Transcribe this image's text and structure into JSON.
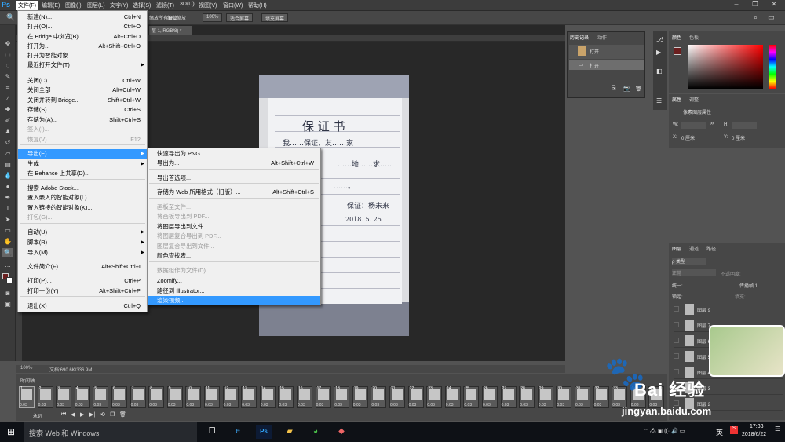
{
  "menubar": {
    "logo": "Ps",
    "items": [
      "文件(F)",
      "编辑(E)",
      "图像(I)",
      "图层(L)",
      "文字(Y)",
      "选择(S)",
      "滤镜(T)",
      "3D(D)",
      "视图(V)",
      "窗口(W)",
      "帮助(H)"
    ]
  },
  "options": {
    "checkbox_window": "缩放所有窗口",
    "fine_zoom": "细微缩放",
    "zoom_value": "100%",
    "fit_screen": "适合屏幕",
    "fill_screen": "填充屏幕"
  },
  "document": {
    "tab": "层 1, RGB/8) *",
    "zoom": "100%",
    "doc_size": "文档:690.6K/336.9M"
  },
  "photo": {
    "title": "保 证 书",
    "line1": "我……保证，友……家",
    "line2": "……地……求……",
    "line3": "……。",
    "signature": "保证：杨未来",
    "date": "2018. 5. 25"
  },
  "file_menu": {
    "items": [
      {
        "label": "新建(N)...",
        "shortcut": "Ctrl+N"
      },
      {
        "label": "打开(O)...",
        "shortcut": "Ctrl+O"
      },
      {
        "label": "在 Bridge 中浏览(B)...",
        "shortcut": "Alt+Ctrl+O"
      },
      {
        "label": "打开为...",
        "shortcut": "Alt+Shift+Ctrl+O"
      },
      {
        "label": "打开为智能对象...",
        "shortcut": ""
      },
      {
        "label": "最近打开文件(T)",
        "shortcut": ""
      },
      {
        "label": "关闭(C)",
        "shortcut": "Ctrl+W"
      },
      {
        "label": "关闭全部",
        "shortcut": "Alt+Ctrl+W"
      },
      {
        "label": "关闭并转到 Bridge...",
        "shortcut": "Shift+Ctrl+W"
      },
      {
        "label": "存储(S)",
        "shortcut": "Ctrl+S"
      },
      {
        "label": "存储为(A)...",
        "shortcut": "Shift+Ctrl+S"
      },
      {
        "label": "签入(I)...",
        "shortcut": ""
      },
      {
        "label": "恢复(V)",
        "shortcut": "F12"
      },
      {
        "label": "导出(E)",
        "shortcut": ""
      },
      {
        "label": "生成",
        "shortcut": ""
      },
      {
        "label": "在 Behance 上共享(D)...",
        "shortcut": ""
      },
      {
        "label": "搜索 Adobe Stock...",
        "shortcut": ""
      },
      {
        "label": "置入嵌入的智能对象(L)...",
        "shortcut": ""
      },
      {
        "label": "置入链接的智能对象(K)...",
        "shortcut": ""
      },
      {
        "label": "打包(G)...",
        "shortcut": ""
      },
      {
        "label": "自动(U)",
        "shortcut": ""
      },
      {
        "label": "脚本(R)",
        "shortcut": ""
      },
      {
        "label": "导入(M)",
        "shortcut": ""
      },
      {
        "label": "文件简介(F)...",
        "shortcut": "Alt+Shift+Ctrl+I"
      },
      {
        "label": "打印(P)...",
        "shortcut": "Ctrl+P"
      },
      {
        "label": "打印一份(Y)",
        "shortcut": "Alt+Shift+Ctrl+P"
      },
      {
        "label": "退出(X)",
        "shortcut": "Ctrl+Q"
      }
    ]
  },
  "export_menu": {
    "items": [
      {
        "label": "快速导出为 PNG",
        "shortcut": ""
      },
      {
        "label": "导出为...",
        "shortcut": "Alt+Shift+Ctrl+W"
      },
      {
        "label": "导出首选项...",
        "shortcut": ""
      },
      {
        "label": "存储为 Web 所用格式（旧版）...",
        "shortcut": "Alt+Shift+Ctrl+S"
      },
      {
        "label": "画板至文件...",
        "shortcut": ""
      },
      {
        "label": "将画板导出到 PDF...",
        "shortcut": ""
      },
      {
        "label": "将图层导出到文件...",
        "shortcut": ""
      },
      {
        "label": "将图层复合导出到 PDF...",
        "shortcut": ""
      },
      {
        "label": "图层复合导出到文件...",
        "shortcut": ""
      },
      {
        "label": "颜色查找表...",
        "shortcut": ""
      },
      {
        "label": "数据组作为文件(D)...",
        "shortcut": ""
      },
      {
        "label": "Zoomify...",
        "shortcut": ""
      },
      {
        "label": "路径到 Illustrator...",
        "shortcut": ""
      },
      {
        "label": "渲染视频...",
        "shortcut": ""
      }
    ]
  },
  "history": {
    "tabs": [
      "历史记录",
      "动作"
    ],
    "rows": [
      "打开",
      "打开"
    ]
  },
  "color": {
    "tabs": [
      "颜色",
      "色板"
    ]
  },
  "properties": {
    "tabs": [
      "属性",
      "调整"
    ],
    "title": "像素图层属性",
    "w": "W:",
    "h": "H:",
    "x_label": "X:",
    "x_value": "0 厘米",
    "y_label": "Y:",
    "y_value": "0 厘米"
  },
  "layers": {
    "tabs": [
      "图层",
      "通道",
      "路径"
    ],
    "filter": "ρ 类型",
    "mode": "正常",
    "opacity_label": "不透明度:",
    "unify": "统一:",
    "propagate": "传播帧 1",
    "lock": "锁定:",
    "fill_label": "填充:",
    "rows": [
      "图层 9",
      "图层 7",
      "图层 6",
      "图层 5",
      "图层 4",
      "图层 3",
      "图层 2"
    ]
  },
  "timeline": {
    "title": "时间轴",
    "loop": "永远",
    "frames": [
      "1",
      "2",
      "3",
      "4",
      "5",
      "6",
      "7",
      "8",
      "9",
      "10",
      "11",
      "12",
      "13",
      "14",
      "15",
      "16",
      "17",
      "18",
      "19",
      "20",
      "21",
      "22",
      "23",
      "24",
      "25",
      "26",
      "27",
      "28",
      "29",
      "30",
      "31",
      "32",
      "33",
      "34",
      "35"
    ],
    "duration": "0.03"
  },
  "taskbar": {
    "search_placeholder": "搜索 Web 和 Windows",
    "ime": "英",
    "time": "17:33",
    "date": "2018/6/22"
  },
  "watermark": {
    "text": "Bai 经验",
    "url": "jingyan.baidu.com"
  },
  "colors": {
    "menu_highlight": "#3399ff",
    "ps_blue": "#31a8ff",
    "panel_bg": "#474747"
  }
}
